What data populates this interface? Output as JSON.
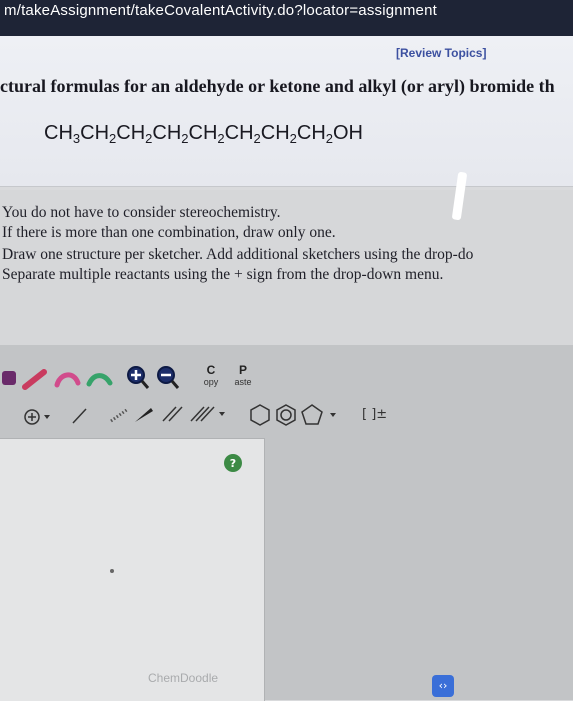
{
  "browser": {
    "url_fragment": "m/takeAssignment/takeCovalentActivity.do?locator=assignment"
  },
  "question": {
    "review_topics": "[Review Topics]",
    "prompt_fragment": "ctural formulas for an aldehyde or ketone and alkyl (or aryl) bromide th",
    "formula_parts": [
      "CH",
      "3",
      "CH",
      "2",
      "CH",
      "2",
      "CH",
      "2",
      "CH",
      "2",
      "CH",
      "2",
      "CH",
      "2",
      "CH",
      "2",
      "OH"
    ]
  },
  "instructions": {
    "lines": [
      "You do not have to consider stereochemistry.",
      "If there is more than one combination, draw only one.",
      "Draw one structure per sketcher. Add additional sketchers using the drop-do",
      "Separate multiple reactants using the + sign from the drop-down menu."
    ]
  },
  "toolbar": {
    "copy_letter": "C",
    "copy_sub": "opy",
    "paste_letter": "P",
    "paste_sub": "aste",
    "bracket_label": "[ ]±"
  },
  "sketcher": {
    "watermark": "ChemDoodle",
    "help_icon_glyph": "?"
  },
  "colors": {
    "url_bar": "#1e2436",
    "review_topics": "#3c50a0",
    "help_button": "#3c8a45",
    "toolbar_icon": "#444444"
  }
}
